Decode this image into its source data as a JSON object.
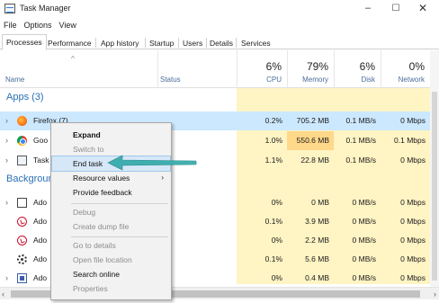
{
  "window": {
    "title": "Task Manager",
    "minimize": "–",
    "maximize": "☐",
    "close": "✕"
  },
  "menu": [
    "File",
    "Options",
    "View"
  ],
  "tabs": [
    "Processes",
    "Performance",
    "App history",
    "Startup",
    "Users",
    "Details",
    "Services"
  ],
  "active_tab": "Processes",
  "columns": {
    "name": "Name",
    "status": "Status",
    "cpu": {
      "pct": "6%",
      "label": "CPU"
    },
    "memory": {
      "pct": "79%",
      "label": "Memory"
    },
    "disk": {
      "pct": "6%",
      "label": "Disk"
    },
    "network": {
      "pct": "0%",
      "label": "Network"
    }
  },
  "groups": {
    "apps": "Apps (3)",
    "background": "Backgroun"
  },
  "rows": [
    {
      "name": "Firefox (7)",
      "cpu": "0.2%",
      "memory": "705.2 MB",
      "disk": "0.1 MB/s",
      "network": "0 Mbps",
      "icon": "firefox-icon",
      "selected": true
    },
    {
      "name": "Goo",
      "cpu": "1.0%",
      "memory": "550.6 MB",
      "disk": "0.1 MB/s",
      "network": "0.1 Mbps",
      "icon": "chrome-icon",
      "hot_memory": true
    },
    {
      "name": "Task",
      "cpu": "1.1%",
      "memory": "22.8 MB",
      "disk": "0.1 MB/s",
      "network": "0 Mbps",
      "icon": "task-manager-icon"
    },
    {
      "name": "Ado",
      "cpu": "0%",
      "memory": "0 MB",
      "disk": "0 MB/s",
      "network": "0 Mbps",
      "icon": "window-icon"
    },
    {
      "name": "Ado",
      "cpu": "0.1%",
      "memory": "3.9 MB",
      "disk": "0 MB/s",
      "network": "0 Mbps",
      "icon": "adobe-icon"
    },
    {
      "name": "Ado",
      "cpu": "0%",
      "memory": "2.2 MB",
      "disk": "0 MB/s",
      "network": "0 Mbps",
      "icon": "adobe-icon"
    },
    {
      "name": "Ado",
      "cpu": "0.1%",
      "memory": "5.6 MB",
      "disk": "0 MB/s",
      "network": "0 Mbps",
      "icon": "gear-icon"
    },
    {
      "name": "Ado",
      "cpu": "0%",
      "memory": "0.4 MB",
      "disk": "0 MB/s",
      "network": "0 Mbps",
      "icon": "windows-app-icon"
    }
  ],
  "context_menu": {
    "items": [
      {
        "label": "Expand",
        "bold": true
      },
      {
        "label": "Switch to",
        "disabled": true
      },
      {
        "label": "End task",
        "hover": true
      },
      {
        "label": "Resource values",
        "submenu_arrow": "›"
      },
      {
        "label": "Provide feedback"
      },
      {
        "label": "Debug",
        "disabled": true
      },
      {
        "label": "Create dump file",
        "disabled": true
      },
      {
        "label": "Go to details",
        "disabled": true
      },
      {
        "label": "Open file location",
        "disabled": true
      },
      {
        "label": "Search online"
      },
      {
        "label": "Properties",
        "disabled": true
      }
    ]
  },
  "colors": {
    "accent": "#2a6fb5",
    "selected_row": "#cce8ff",
    "cpu_bg": "#fff4c4",
    "hot_memory": "#ffd88a",
    "arrow": "#33aaaa"
  },
  "scroll": {
    "left": "‹",
    "right": "›"
  }
}
